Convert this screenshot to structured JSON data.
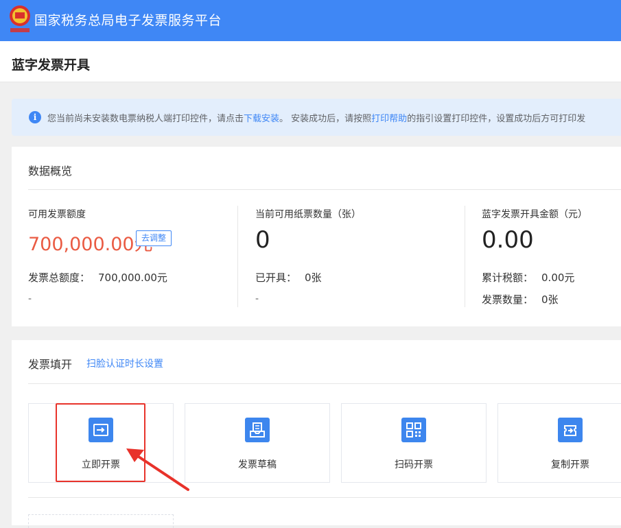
{
  "header": {
    "app_title": "国家税务总局电子发票服务平台",
    "logo_icon": "tax-emblem-icon",
    "brand_color": "#3f87f5"
  },
  "page": {
    "title": "蓝字发票开具"
  },
  "notice": {
    "icon": "info-icon",
    "text_before": "您当前尚未安装数电票纳税人端打印控件，请点击",
    "link_download": "下载安装",
    "text_middle": "。 安装成功后，请按照",
    "link_help": "打印帮助",
    "text_after": "的指引设置打印控件，设置成功后方可打印发"
  },
  "overview": {
    "heading": "数据概览",
    "col1": {
      "label": "可用发票额度",
      "value": "700,000.00元",
      "adjust_button": "去调整",
      "total_label": "发票总额度：",
      "total_value": "700,000.00元",
      "dash": "-"
    },
    "col2": {
      "label": "当前可用纸票数量（张）",
      "value": "0",
      "issued_label": "已开具：",
      "issued_value": "0张",
      "dash": "-"
    },
    "col3": {
      "label": "蓝字发票开具金额（元）",
      "value": "0.00",
      "tax_label": "累计税额：",
      "tax_value": "0.00元",
      "count_label": "发票数量：",
      "count_value": "0张"
    },
    "accent_color": "#ea5b43"
  },
  "fill": {
    "heading": "发票填开",
    "setting_link": "扫脸认证时长设置",
    "tiles": [
      {
        "label": "立即开票",
        "icon": "issue-now-icon"
      },
      {
        "label": "发票草稿",
        "icon": "draft-tray-icon"
      },
      {
        "label": "扫码开票",
        "icon": "qr-code-icon"
      },
      {
        "label": "复制开票",
        "icon": "copy-ticket-icon"
      }
    ],
    "annotation_color": "#e8322a"
  }
}
